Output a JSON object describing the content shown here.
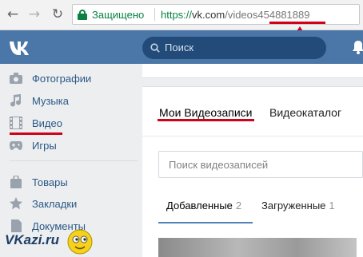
{
  "browser": {
    "secure_label": "Защищено",
    "url_scheme": "https://",
    "url_host": "vk.com",
    "url_path": "/videos",
    "url_id": "454881889"
  },
  "header": {
    "search_placeholder": "Поиск"
  },
  "sidebar": {
    "items": [
      {
        "label": "Фотографии",
        "icon": "camera-icon"
      },
      {
        "label": "Музыка",
        "icon": "music-note-icon"
      },
      {
        "label": "Видео",
        "icon": "film-icon"
      },
      {
        "label": "Игры",
        "icon": "gamepad-icon"
      },
      {
        "label": "Товары",
        "icon": "shopping-bag-icon"
      },
      {
        "label": "Закладки",
        "icon": "star-icon"
      },
      {
        "label": "Документы",
        "icon": "document-icon"
      }
    ]
  },
  "main": {
    "tabs": [
      {
        "label": "Мои Видеозаписи"
      },
      {
        "label": "Видеокаталог"
      }
    ],
    "video_search_placeholder": "Поиск видеозаписей",
    "subtabs": [
      {
        "label": "Добавленные",
        "count": "2"
      },
      {
        "label": "Загруженные",
        "count": "1"
      }
    ]
  },
  "watermark": {
    "text": "VKazi.ru"
  },
  "colors": {
    "vk_blue": "#4a76a8",
    "annotation_red": "#d0021b",
    "secure_green": "#0b8043",
    "link_blue": "#2a5885"
  }
}
